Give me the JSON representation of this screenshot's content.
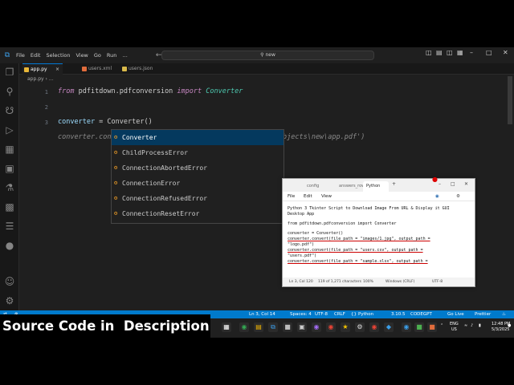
{
  "titlebar": {
    "menus": [
      "File",
      "Edit",
      "Selection",
      "View",
      "Go",
      "Run",
      "…"
    ],
    "search": "new"
  },
  "tabs": [
    {
      "label": "app.py",
      "active": true,
      "color": "#e8b739"
    },
    {
      "label": "users.xml",
      "active": false,
      "color": "#e06c3c"
    },
    {
      "label": "users.json",
      "active": false,
      "color": "#d9b94a"
    }
  ],
  "breadcrumb": "app.py › …",
  "editor": {
    "line_numbers": [
      "1",
      "2",
      "3"
    ],
    "line1": {
      "kw_from": "from",
      "module": " pdfitdown.pdfconversion ",
      "kw_import": "import",
      "cls": " Converter"
    },
    "line3": {
      "var": "converter",
      "eq": " = ",
      "typed": "Converter()"
    },
    "line4_left": "converter.con",
    "line4_right": "bjects\\new\\app.pdf')"
  },
  "suggestions": [
    {
      "label": "Converter",
      "selected": true
    },
    {
      "label": "ChildProcessError",
      "selected": false
    },
    {
      "label": "ConnectionAbortedError",
      "selected": false
    },
    {
      "label": "ConnectionError",
      "selected": false
    },
    {
      "label": "ConnectionRefusedError",
      "selected": false
    },
    {
      "label": "ConnectionResetError",
      "selected": false
    }
  ],
  "notepad": {
    "tabs": [
      "config",
      "answers_rows",
      "Python"
    ],
    "menus": [
      "File",
      "Edit",
      "View"
    ],
    "lines": [
      "Python 3 Tkinter Script to Download Image From URL & Display it GUI",
      "Desktop App",
      "",
      "from pdfitdown.pdfconversion import Converter",
      "",
      "converter = Converter()",
      "converter.convert(file_path = \"images/1.jpg\", output_path =",
      "\"logo.pdf\")",
      "converter.convert(file_path = \"users.csv\", output_path =",
      "\"users.pdf\")",
      "converter.convert(file_path = \"sample.xlsx\", output_path ="
    ],
    "status": {
      "position": "Ln 3, Col 120",
      "chars": "119 of 1,271 characters",
      "zoom": "100%",
      "eol": "Windows (CRLF)",
      "encoding": "UTF-8"
    }
  },
  "statusbar": {
    "cursor": "Ln 3, Col 14",
    "spaces": "Spaces: 4",
    "encoding": "UTF-8",
    "eol": "CRLF",
    "language": "Python",
    "version": "3.10.5",
    "codegpt": "CODEGPT",
    "golive": "Go Live",
    "prettier": "Prettier"
  },
  "taskbar": {
    "lang": "ENG",
    "region": "US",
    "time": "12:48 PM",
    "date": "5/3/2025"
  },
  "caption": "Source Code in  Description",
  "colors": {
    "accent": "#007acc",
    "editor_bg": "#1f1f1f",
    "selection": "#04395e"
  }
}
